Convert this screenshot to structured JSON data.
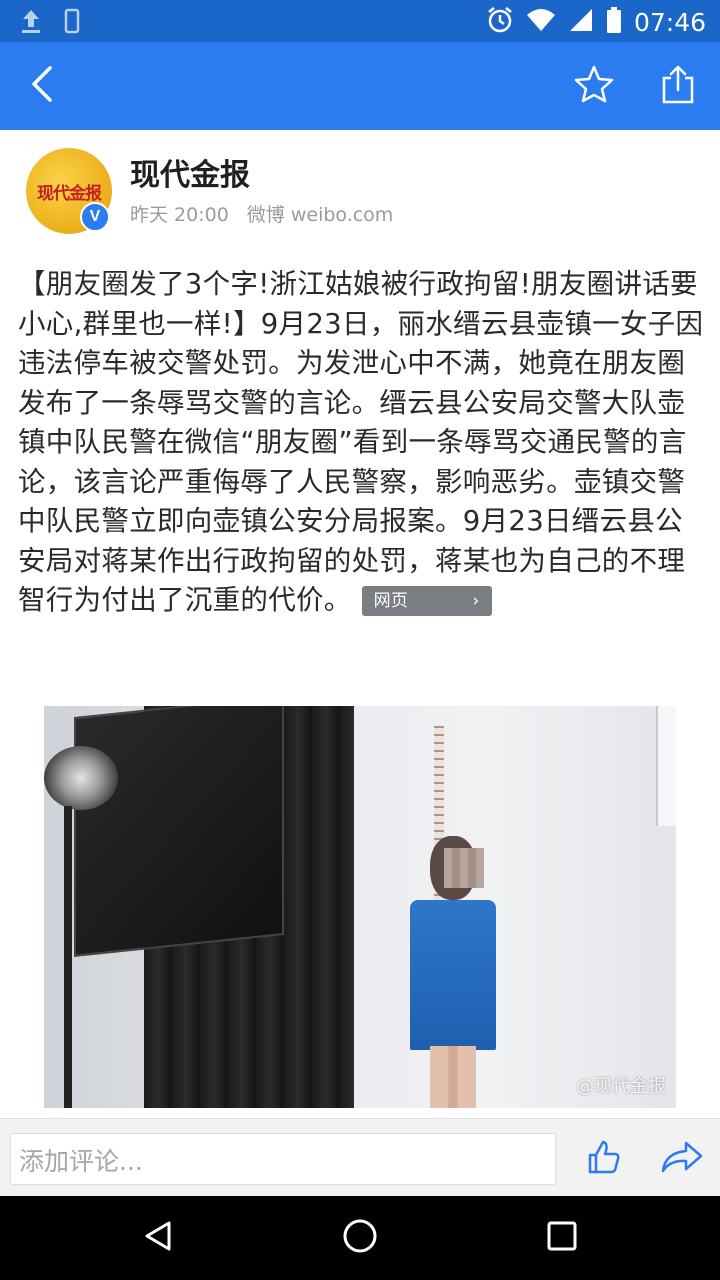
{
  "status_bar": {
    "time": "07:46",
    "icons": [
      "upload-icon",
      "phone-icon",
      "alarm-icon",
      "wifi-icon",
      "signal-icon",
      "battery-icon"
    ]
  },
  "app_bar": {
    "icons": [
      "back-icon",
      "star-icon",
      "share-icon"
    ],
    "color": "#2a7cf0"
  },
  "author": {
    "name": "现代金报",
    "avatar_text": "现代金报",
    "verified_label": "V",
    "time": "昨天 20:00",
    "source": "微博 weibo.com"
  },
  "article": {
    "text": "【朋友圈发了3个字!浙江姑娘被行政拘留!朋友圈讲话要小心,群里也一样!】9月23日，丽水缙云县壶镇一女子因违法停车被交警处罚。为发泄心中不满，她竟在朋友圈发布了一条辱骂交警的言论。缙云县公安局交警大队壶镇中队民警在微信“朋友圈”看到一条辱骂交通民警的言论，该言论严重侮辱了人民警察，影响恶劣。壶镇交警中队民警立即向壶镇公安分局报案。9月23日缙云县公安局对蒋某作出行政拘留的处罚，蒋某也为自己的不理智行为付出了沉重的代价。",
    "link_label": "网页",
    "link_arrow": "›"
  },
  "photo": {
    "watermark": "@现代金报"
  },
  "comment_bar": {
    "placeholder": "添加评论...",
    "icons": [
      "like-icon",
      "forward-icon"
    ]
  },
  "nav_bar": {
    "icons": [
      "nav-back-icon",
      "nav-home-icon",
      "nav-recent-icon"
    ]
  }
}
